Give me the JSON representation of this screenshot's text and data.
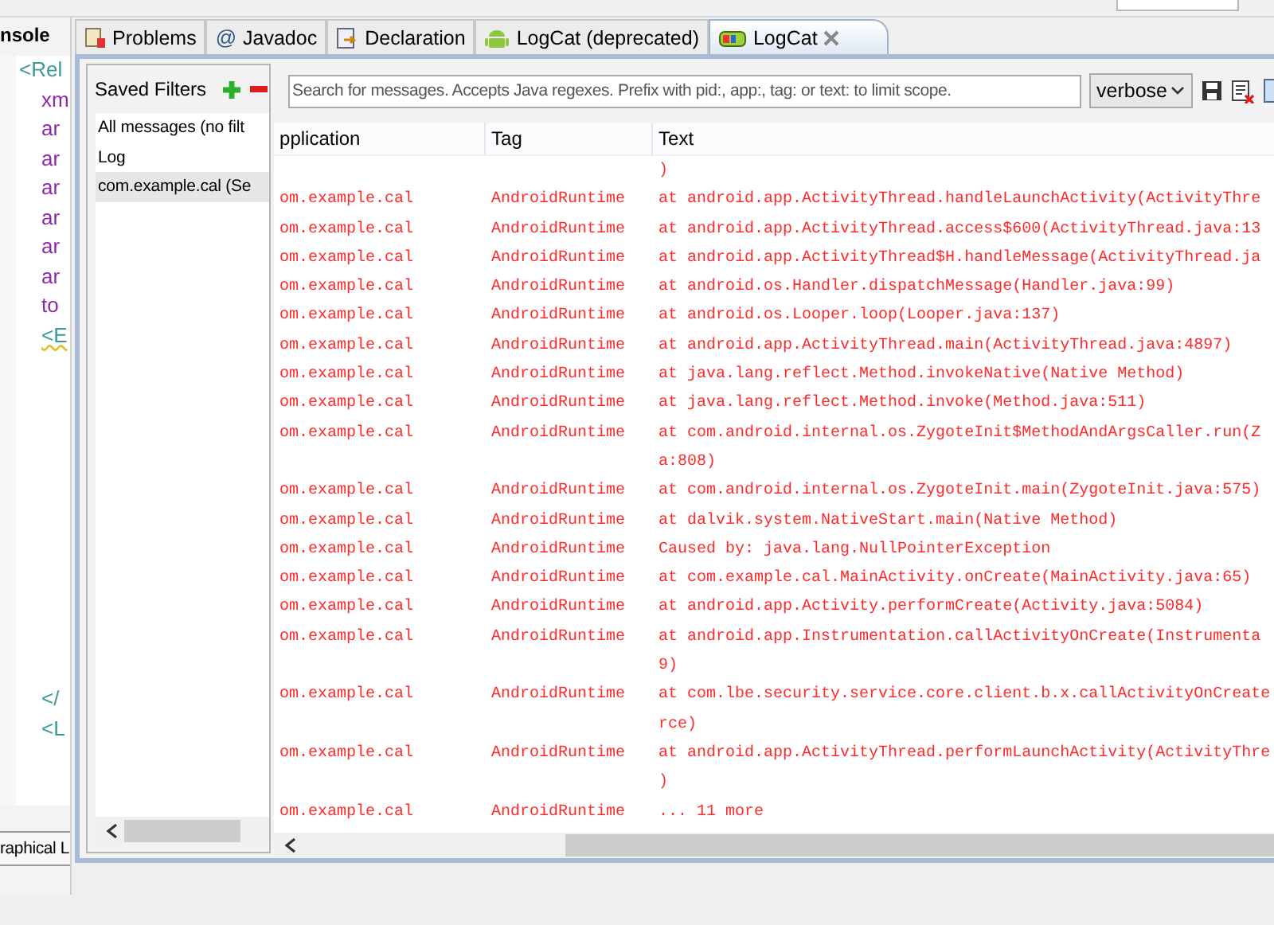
{
  "editor": {
    "tab_label": "nsole",
    "code_blocks": [
      [
        {
          "text": "<Rel",
          "kind": "tag"
        },
        {
          "text": "xm",
          "kind": "attr"
        },
        {
          "text": "ar",
          "kind": "attr"
        },
        {
          "text": "ar",
          "kind": "attr"
        },
        {
          "text": "ar",
          "kind": "attr"
        },
        {
          "text": "ar",
          "kind": "attr"
        },
        {
          "text": "ar",
          "kind": "attr"
        },
        {
          "text": "ar",
          "kind": "attr"
        },
        {
          "text": "to",
          "kind": "attr"
        },
        {
          "text": "<E",
          "kind": "warning"
        }
      ],
      [
        {
          "text": "</",
          "kind": "tag"
        },
        {
          "text": "<L",
          "kind": "tag"
        }
      ]
    ],
    "bottom_tab": "raphical L"
  },
  "tabs": [
    {
      "label": "Problems",
      "kind": "problems",
      "selected": false
    },
    {
      "label": "Javadoc",
      "kind": "javadoc",
      "icon_text": "@",
      "selected": false
    },
    {
      "label": "Declaration",
      "kind": "declaration",
      "selected": false
    },
    {
      "label": "LogCat (deprecated)",
      "kind": "android",
      "selected": false
    },
    {
      "label": "LogCat",
      "kind": "logcat",
      "selected": true
    }
  ],
  "saved_filters": {
    "title": "Saved Filters",
    "items": [
      {
        "label": "All messages (no filt",
        "selected": false
      },
      {
        "label": "Log",
        "selected": false
      },
      {
        "label": "com.example.cal (Se",
        "selected": true
      }
    ]
  },
  "search": {
    "placeholder": "Search for messages. Accepts Java regexes. Prefix with pid:, app:, tag: or text: to limit scope."
  },
  "level_select": {
    "value": "verbose"
  },
  "table": {
    "columns": [
      "pplication",
      "Tag",
      "Text"
    ],
    "rows": [
      {
        "text": ")"
      },
      {
        "application": "om.example.cal",
        "tag": "AndroidRuntime",
        "text": "at android.app.ActivityThread.handleLaunchActivity(ActivityThre"
      },
      {
        "application": "om.example.cal",
        "tag": "AndroidRuntime",
        "text": "at android.app.ActivityThread.access$600(ActivityThread.java:13"
      },
      {
        "application": "om.example.cal",
        "tag": "AndroidRuntime",
        "text": "at android.app.ActivityThread$H.handleMessage(ActivityThread.ja"
      },
      {
        "application": "om.example.cal",
        "tag": "AndroidRuntime",
        "text": "at android.os.Handler.dispatchMessage(Handler.java:99)"
      },
      {
        "application": "om.example.cal",
        "tag": "AndroidRuntime",
        "text": "at android.os.Looper.loop(Looper.java:137)"
      },
      {
        "application": "om.example.cal",
        "tag": "AndroidRuntime",
        "text": "at android.app.ActivityThread.main(ActivityThread.java:4897)"
      },
      {
        "application": "om.example.cal",
        "tag": "AndroidRuntime",
        "text": "at java.lang.reflect.Method.invokeNative(Native Method)"
      },
      {
        "application": "om.example.cal",
        "tag": "AndroidRuntime",
        "text": "at java.lang.reflect.Method.invoke(Method.java:511)"
      },
      {
        "application": "om.example.cal",
        "tag": "AndroidRuntime",
        "text": "at com.android.internal.os.ZygoteInit$MethodAndArgsCaller.run(Z",
        "continuation": "a:808)"
      },
      {
        "application": "om.example.cal",
        "tag": "AndroidRuntime",
        "text": "at com.android.internal.os.ZygoteInit.main(ZygoteInit.java:575)"
      },
      {
        "application": "om.example.cal",
        "tag": "AndroidRuntime",
        "text": "at dalvik.system.NativeStart.main(Native Method)"
      },
      {
        "application": "om.example.cal",
        "tag": "AndroidRuntime",
        "text": "Caused by: java.lang.NullPointerException"
      },
      {
        "application": "om.example.cal",
        "tag": "AndroidRuntime",
        "text": "at com.example.cal.MainActivity.onCreate(MainActivity.java:65)"
      },
      {
        "application": "om.example.cal",
        "tag": "AndroidRuntime",
        "text": "at android.app.Activity.performCreate(Activity.java:5084)"
      },
      {
        "application": "om.example.cal",
        "tag": "AndroidRuntime",
        "text": "at android.app.Instrumentation.callActivityOnCreate(Instrumenta",
        "continuation": "9)"
      },
      {
        "application": "om.example.cal",
        "tag": "AndroidRuntime",
        "text": "at com.lbe.security.service.core.client.b.x.callActivityOnCreate",
        "continuation": "rce)"
      },
      {
        "application": "om.example.cal",
        "tag": "AndroidRuntime",
        "text": "at android.app.ActivityThread.performLaunchActivity(ActivityThre",
        "continuation": ")"
      },
      {
        "application": "om.example.cal",
        "tag": "AndroidRuntime",
        "text": "... 11 more"
      }
    ]
  }
}
